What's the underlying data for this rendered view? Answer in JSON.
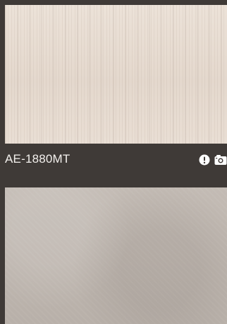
{
  "items": [
    {
      "code": "AE-1880MT",
      "icons": [
        "info-icon",
        "camera-icon"
      ],
      "swatch_color": "#e8ddd3"
    },
    {
      "swatch_color": "#bdb5ae"
    }
  ],
  "colors": {
    "background": "#3f3a37",
    "text": "#f3f0ed"
  }
}
